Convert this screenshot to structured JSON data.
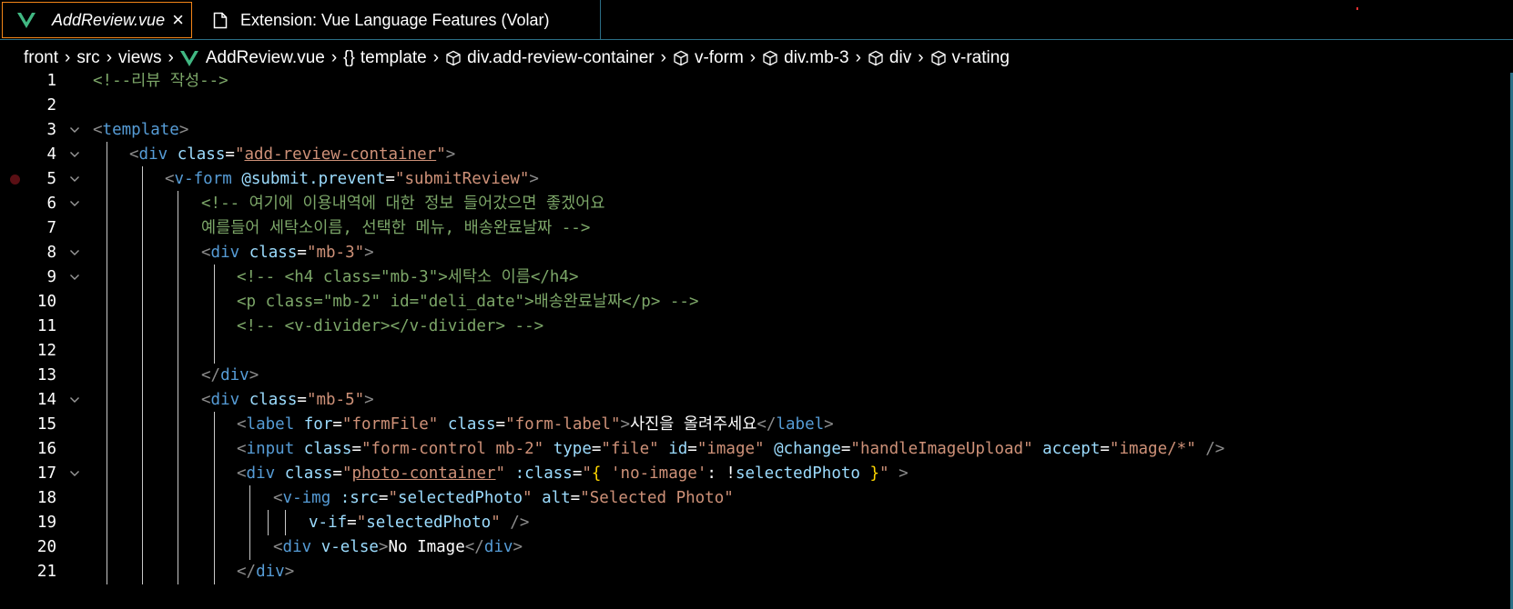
{
  "tabs": [
    {
      "label": "AddReview.vue",
      "icon": "vue-icon",
      "active": true,
      "close": "×"
    },
    {
      "label": "Extension: Vue Language Features (Volar)",
      "icon": "file-icon",
      "active": false
    }
  ],
  "breadcrumb": [
    {
      "label": "front",
      "icon": ""
    },
    {
      "label": "src",
      "icon": ""
    },
    {
      "label": "views",
      "icon": ""
    },
    {
      "label": "AddReview.vue",
      "icon": "vue-icon"
    },
    {
      "label": "template",
      "icon": "braces-icon"
    },
    {
      "label": "div.add-review-container",
      "icon": "cube-icon"
    },
    {
      "label": "v-form",
      "icon": "cube-icon"
    },
    {
      "label": "div.mb-3",
      "icon": "cube-icon"
    },
    {
      "label": "div",
      "icon": "cube-icon"
    },
    {
      "label": "v-rating",
      "icon": "cube-icon"
    }
  ],
  "editor": {
    "breakpoint_line": 5,
    "lines": [
      {
        "num": "1",
        "fold": false,
        "tokens": [
          [
            "cm",
            "<!--리뷰 작성-->"
          ]
        ]
      },
      {
        "num": "2",
        "fold": false,
        "tokens": []
      },
      {
        "num": "3",
        "fold": true,
        "tokens": [
          [
            "pn",
            "<"
          ],
          [
            "tg",
            "template"
          ],
          [
            "pn",
            ">"
          ]
        ]
      },
      {
        "num": "4",
        "fold": true,
        "tokens": [
          [
            "pn",
            "<"
          ],
          [
            "tg",
            "div "
          ],
          [
            "at",
            "class"
          ],
          [
            "tx",
            "="
          ],
          [
            "st",
            "\""
          ],
          [
            "stu",
            "add-review-container"
          ],
          [
            "st",
            "\""
          ],
          [
            "pn",
            ">"
          ]
        ]
      },
      {
        "num": "5",
        "fold": true,
        "tokens": [
          [
            "pn",
            "<"
          ],
          [
            "tg",
            "v-form "
          ],
          [
            "at",
            "@submit.prevent"
          ],
          [
            "tx",
            "="
          ],
          [
            "st",
            "\"submitReview\""
          ],
          [
            "pn",
            ">"
          ]
        ]
      },
      {
        "num": "6",
        "fold": true,
        "tokens": [
          [
            "cm",
            "<!-- 여기에 이용내역에 대한 정보 들어갔으면 좋겠어요"
          ]
        ]
      },
      {
        "num": "7",
        "fold": false,
        "tokens": [
          [
            "cm",
            "예를들어 세탁소이름, 선택한 메뉴, 배송완료날짜 -->"
          ]
        ]
      },
      {
        "num": "8",
        "fold": true,
        "tokens": [
          [
            "pn",
            "<"
          ],
          [
            "tg",
            "div "
          ],
          [
            "at",
            "class"
          ],
          [
            "tx",
            "="
          ],
          [
            "st",
            "\"mb-3\""
          ],
          [
            "pn",
            ">"
          ]
        ]
      },
      {
        "num": "9",
        "fold": true,
        "tokens": [
          [
            "cm",
            "<!-- <h4 class=\"mb-3\">세탁소 이름</h4>"
          ]
        ]
      },
      {
        "num": "10",
        "fold": false,
        "tokens": [
          [
            "cm",
            "<p class=\"mb-2\" id=\"deli_date\">배송완료날짜</p> -->"
          ]
        ]
      },
      {
        "num": "11",
        "fold": false,
        "tokens": [
          [
            "cm",
            "<!-- <v-divider></v-divider> -->"
          ]
        ]
      },
      {
        "num": "12",
        "fold": false,
        "tokens": []
      },
      {
        "num": "13",
        "fold": false,
        "tokens": [
          [
            "pn",
            "</"
          ],
          [
            "tg",
            "div"
          ],
          [
            "pn",
            ">"
          ]
        ]
      },
      {
        "num": "14",
        "fold": true,
        "tokens": [
          [
            "pn",
            "<"
          ],
          [
            "tg",
            "div "
          ],
          [
            "at",
            "class"
          ],
          [
            "tx",
            "="
          ],
          [
            "st",
            "\"mb-5\""
          ],
          [
            "pn",
            ">"
          ]
        ]
      },
      {
        "num": "15",
        "fold": false,
        "tokens": [
          [
            "pn",
            "<"
          ],
          [
            "tg",
            "label "
          ],
          [
            "at",
            "for"
          ],
          [
            "tx",
            "="
          ],
          [
            "st",
            "\"formFile\" "
          ],
          [
            "at",
            "class"
          ],
          [
            "tx",
            "="
          ],
          [
            "st",
            "\"form-label\""
          ],
          [
            "pn",
            ">"
          ],
          [
            "tx",
            "사진을 올려주세요"
          ],
          [
            "pn",
            "</"
          ],
          [
            "tg",
            "label"
          ],
          [
            "pn",
            ">"
          ]
        ]
      },
      {
        "num": "16",
        "fold": false,
        "tokens": [
          [
            "pn",
            "<"
          ],
          [
            "tg",
            "input "
          ],
          [
            "at",
            "class"
          ],
          [
            "tx",
            "="
          ],
          [
            "st",
            "\"form-control mb-2\" "
          ],
          [
            "at",
            "type"
          ],
          [
            "tx",
            "="
          ],
          [
            "st",
            "\"file\" "
          ],
          [
            "at",
            "id"
          ],
          [
            "tx",
            "="
          ],
          [
            "st",
            "\"image\" "
          ],
          [
            "at",
            "@change"
          ],
          [
            "tx",
            "="
          ],
          [
            "st",
            "\"handleImageUpload\" "
          ],
          [
            "at",
            "accept"
          ],
          [
            "tx",
            "="
          ],
          [
            "st",
            "\"image/*\" "
          ],
          [
            "pn",
            "/>"
          ]
        ]
      },
      {
        "num": "17",
        "fold": true,
        "tokens": [
          [
            "pn",
            "<"
          ],
          [
            "tg",
            "div "
          ],
          [
            "at",
            "class"
          ],
          [
            "tx",
            "="
          ],
          [
            "st",
            "\""
          ],
          [
            "stu",
            "photo-container"
          ],
          [
            "st",
            "\" "
          ],
          [
            "at",
            ":class"
          ],
          [
            "tx",
            "="
          ],
          [
            "st",
            "\""
          ],
          [
            "br",
            "{ "
          ],
          [
            "st",
            "'no-image'"
          ],
          [
            "tx",
            ": !"
          ],
          [
            "at",
            "selectedPhoto"
          ],
          [
            "br",
            " }"
          ],
          [
            "st",
            "\" "
          ],
          [
            "pn",
            ">"
          ]
        ]
      },
      {
        "num": "18",
        "fold": false,
        "tokens": [
          [
            "pn",
            "<"
          ],
          [
            "tg",
            "v-img "
          ],
          [
            "at",
            ":src"
          ],
          [
            "tx",
            "="
          ],
          [
            "st",
            "\""
          ],
          [
            "at",
            "selectedPhoto"
          ],
          [
            "st",
            "\" "
          ],
          [
            "at",
            "alt"
          ],
          [
            "tx",
            "="
          ],
          [
            "st",
            "\"Selected Photo\""
          ]
        ]
      },
      {
        "num": "19",
        "fold": false,
        "tokens": [
          [
            "at",
            "v-if"
          ],
          [
            "tx",
            "="
          ],
          [
            "st",
            "\""
          ],
          [
            "at",
            "selectedPhoto"
          ],
          [
            "st",
            "\" "
          ],
          [
            "pn",
            "/>"
          ]
        ]
      },
      {
        "num": "20",
        "fold": false,
        "tokens": [
          [
            "pn",
            "<"
          ],
          [
            "tg",
            "div "
          ],
          [
            "at",
            "v-else"
          ],
          [
            "pn",
            ">"
          ],
          [
            "tx",
            "No Image"
          ],
          [
            "pn",
            "</"
          ],
          [
            "tg",
            "div"
          ],
          [
            "pn",
            ">"
          ]
        ]
      },
      {
        "num": "21",
        "fold": false,
        "tokens": [
          [
            "pn",
            "</"
          ],
          [
            "tg",
            "div"
          ],
          [
            "pn",
            ">"
          ]
        ]
      }
    ]
  },
  "colors": {
    "background": "#000000",
    "active_tab_border": "#f38518",
    "border": "#2b6f86",
    "comment": "#7ca668",
    "tag": "#569cd6",
    "attribute": "#9cdcfe",
    "string": "#ce9178",
    "bracket": "#ffd700",
    "vue_green": "#41b883"
  }
}
